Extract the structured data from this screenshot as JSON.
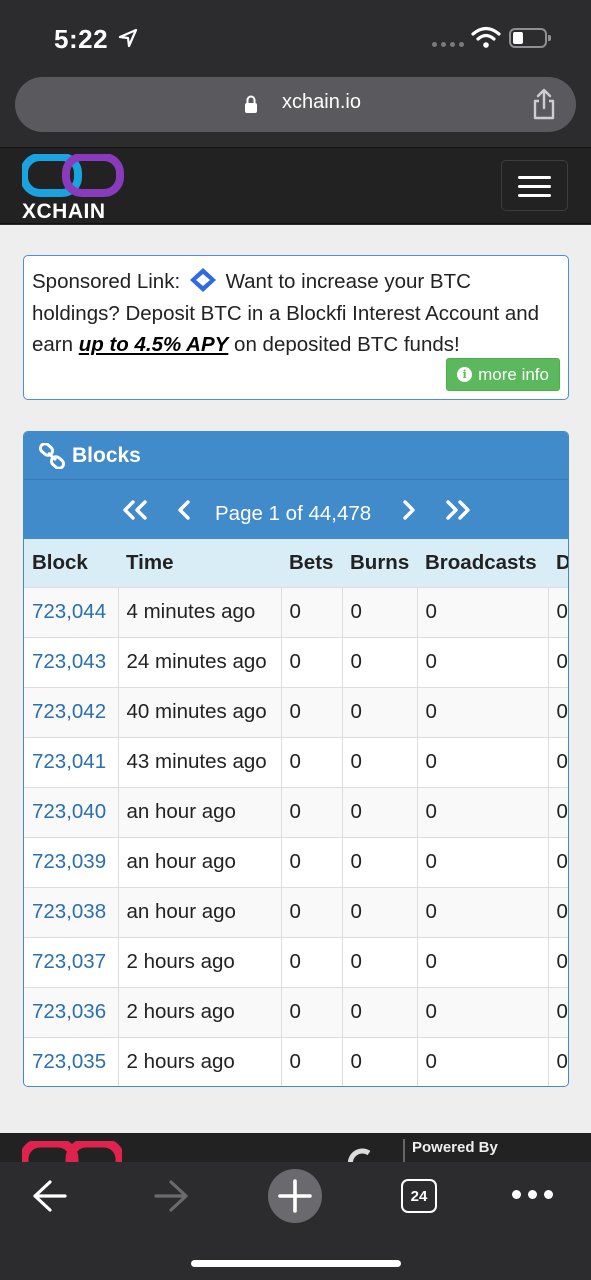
{
  "status_bar": {
    "time": "5:22"
  },
  "browser": {
    "url": "xchain.io",
    "tab_count": "24"
  },
  "site": {
    "brand": "XCHAIN"
  },
  "sponsor": {
    "label": "Sponsored Link:",
    "text_1": "Want to increase your BTC holdings? Deposit BTC in a Blockfi Interest Account and earn",
    "apy_link": "up to 4.5% APY",
    "text_2": "on deposited BTC funds!",
    "button": "more info"
  },
  "blocks_panel": {
    "title": "Blocks",
    "page_info": "Page 1 of 44,478",
    "columns": [
      "Block",
      "Time",
      "Bets",
      "Burns",
      "Broadcasts",
      "D"
    ],
    "rows": [
      [
        "723,044",
        "4 minutes ago",
        "0",
        "0",
        "0",
        "0"
      ],
      [
        "723,043",
        "24 minutes ago",
        "0",
        "0",
        "0",
        "0"
      ],
      [
        "723,042",
        "40 minutes ago",
        "0",
        "0",
        "0",
        "0"
      ],
      [
        "723,041",
        "43 minutes ago",
        "0",
        "0",
        "0",
        "0"
      ],
      [
        "723,040",
        "an hour ago",
        "0",
        "0",
        "0",
        "0"
      ],
      [
        "723,039",
        "an hour ago",
        "0",
        "0",
        "0",
        "0"
      ],
      [
        "723,038",
        "an hour ago",
        "0",
        "0",
        "0",
        "0"
      ],
      [
        "723,037",
        "2 hours ago",
        "0",
        "0",
        "0",
        "0"
      ],
      [
        "723,036",
        "2 hours ago",
        "0",
        "0",
        "0",
        "0"
      ],
      [
        "723,035",
        "2 hours ago",
        "0",
        "0",
        "0",
        "0"
      ]
    ]
  },
  "footer": {
    "powered_by": "Powered By"
  },
  "colors": {
    "primary": "#428bca",
    "success": "#5cb85c",
    "navbar": "#222222",
    "link": "#2a6fb0"
  }
}
